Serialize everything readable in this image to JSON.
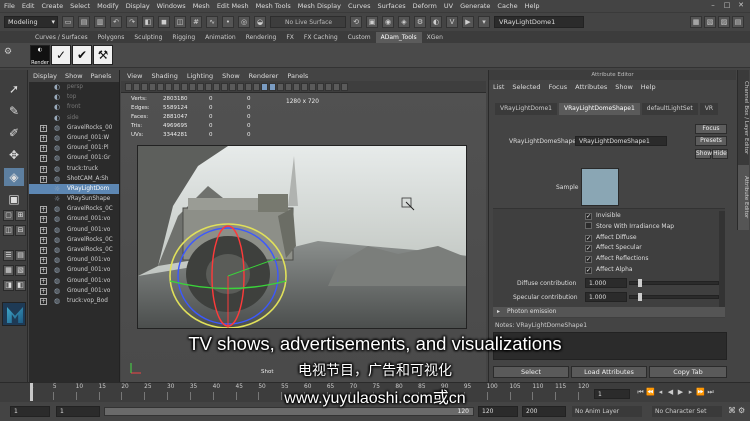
{
  "menubar": {
    "items": [
      "File",
      "Edit",
      "Create",
      "Select",
      "Modify",
      "Display",
      "Windows",
      "Mesh",
      "Edit Mesh",
      "Mesh Tools",
      "Mesh Display",
      "Curves",
      "Surfaces",
      "Deform",
      "UV",
      "Generate",
      "Cache",
      "Help"
    ]
  },
  "statusline": {
    "mode": "Modeling",
    "no_live_surface": "No Live Surface",
    "object_name": "VRayLightDome1"
  },
  "shelf": {
    "tabs": [
      "Curves / Surfaces",
      "Polygons",
      "Sculpting",
      "Rigging",
      "Animation",
      "Rendering",
      "FX",
      "FX Caching",
      "Custom",
      "ADam_Tools",
      "XGen"
    ],
    "active_tab": "ADam_Tools",
    "render_icon_label": "Render"
  },
  "outliner": {
    "menu": [
      "Display",
      "Show",
      "Panels"
    ],
    "items": [
      {
        "label": "persp",
        "expand": false,
        "style": "dim"
      },
      {
        "label": "top",
        "expand": false,
        "style": "dim"
      },
      {
        "label": "front",
        "expand": false,
        "style": "dim"
      },
      {
        "label": "side",
        "expand": false,
        "style": "dim"
      },
      {
        "label": "GravelRocks_00",
        "expand": true,
        "style": ""
      },
      {
        "label": "Ground_001:W",
        "expand": true,
        "style": ""
      },
      {
        "label": "Ground_001:Pl",
        "expand": true,
        "style": ""
      },
      {
        "label": "Ground_001:Gr",
        "expand": true,
        "style": ""
      },
      {
        "label": "truck:truck",
        "expand": true,
        "style": ""
      },
      {
        "label": "ShotCAM_A:Sh",
        "expand": true,
        "style": ""
      },
      {
        "label": "VRayLightDom",
        "expand": false,
        "style": "hi"
      },
      {
        "label": "VRaySunShape",
        "expand": false,
        "style": ""
      },
      {
        "label": "GravelRocks_0C",
        "expand": true,
        "style": ""
      },
      {
        "label": "Ground_001:vo",
        "expand": true,
        "style": ""
      },
      {
        "label": "Ground_001:vo",
        "expand": true,
        "style": ""
      },
      {
        "label": "GravelRocks_0C",
        "expand": true,
        "style": ""
      },
      {
        "label": "GravelRocks_0C",
        "expand": true,
        "style": ""
      },
      {
        "label": "Ground_001:vo",
        "expand": true,
        "style": ""
      },
      {
        "label": "Ground_001:vo",
        "expand": true,
        "style": ""
      },
      {
        "label": "Ground_001:vo",
        "expand": true,
        "style": ""
      },
      {
        "label": "Ground_001:vo",
        "expand": true,
        "style": ""
      },
      {
        "label": "truck:vop_Bod",
        "expand": true,
        "style": ""
      }
    ]
  },
  "viewport": {
    "menu": [
      "View",
      "Shading",
      "Lighting",
      "Show",
      "Renderer",
      "Panels"
    ],
    "hud": [
      {
        "k": "Verts:",
        "v": "2803180",
        "a": "0",
        "b": "0"
      },
      {
        "k": "Edges:",
        "v": "5589124",
        "a": "0",
        "b": "0"
      },
      {
        "k": "Faces:",
        "v": "2881047",
        "a": "0",
        "b": "0"
      },
      {
        "k": "Tris:",
        "v": "4969695",
        "a": "0",
        "b": "0"
      },
      {
        "k": "UVs:",
        "v": "3344281",
        "a": "0",
        "b": "0"
      }
    ],
    "resolution": "1280 x 720",
    "cam_label": "Shot"
  },
  "attribute_editor": {
    "title": "Attribute Editor",
    "menu": [
      "List",
      "Selected",
      "Focus",
      "Attributes",
      "Show",
      "Help"
    ],
    "tabs": [
      "VRayLightDome1",
      "VRayLightDomeShape1",
      "defaultLightSet",
      "VR"
    ],
    "active_tab": "VRayLightDomeShape1",
    "shape_label": "VRayLightDomeShape:",
    "shape_value": "VRayLightDomeShape1",
    "focus": "Focus",
    "presets": "Presets",
    "show": "Show",
    "hide": "Hide",
    "sample_label": "Sample",
    "checkboxes": [
      {
        "label": "Invisible",
        "checked": true
      },
      {
        "label": "Store With Irradiance Map",
        "checked": false
      },
      {
        "label": "Affect Diffuse",
        "checked": true
      },
      {
        "label": "Affect Specular",
        "checked": true
      },
      {
        "label": "Affect Reflections",
        "checked": true
      },
      {
        "label": "Affect Alpha",
        "checked": true
      }
    ],
    "diffuse_label": "Diffuse contribution",
    "diffuse_value": "1.000",
    "specular_label": "Specular contribution",
    "specular_value": "1.000",
    "section": "Photon emission",
    "notes_label": "Notes: VRayLightDomeShape1",
    "buttons": [
      "Select",
      "Load Attributes",
      "Copy Tab"
    ],
    "side_tabs": [
      "Channel Box / Layer Editor",
      "Attribute Editor"
    ]
  },
  "timeslider": {
    "ticks": [
      "1",
      "5",
      "10",
      "15",
      "20",
      "25",
      "30",
      "35",
      "40",
      "45",
      "50",
      "55",
      "60",
      "65",
      "70",
      "75",
      "80",
      "85",
      "90",
      "95",
      "100",
      "105",
      "110",
      "115",
      "120"
    ],
    "current_frame": "1"
  },
  "range": {
    "start": "1",
    "start2": "1",
    "end": "120",
    "end2": "200",
    "anim_layer": "No Anim Layer",
    "char_set": "No Character Set",
    "range_slider_value": "120"
  },
  "subtitles": {
    "en": "TV shows, advertisements, and visualizations",
    "zh": "电视节目，广告和可视化",
    "url": "www.yuyulaoshi.com或cn"
  },
  "colors": {
    "selection": "#5d87b3",
    "sample_swatch": "#8aa6b4"
  }
}
